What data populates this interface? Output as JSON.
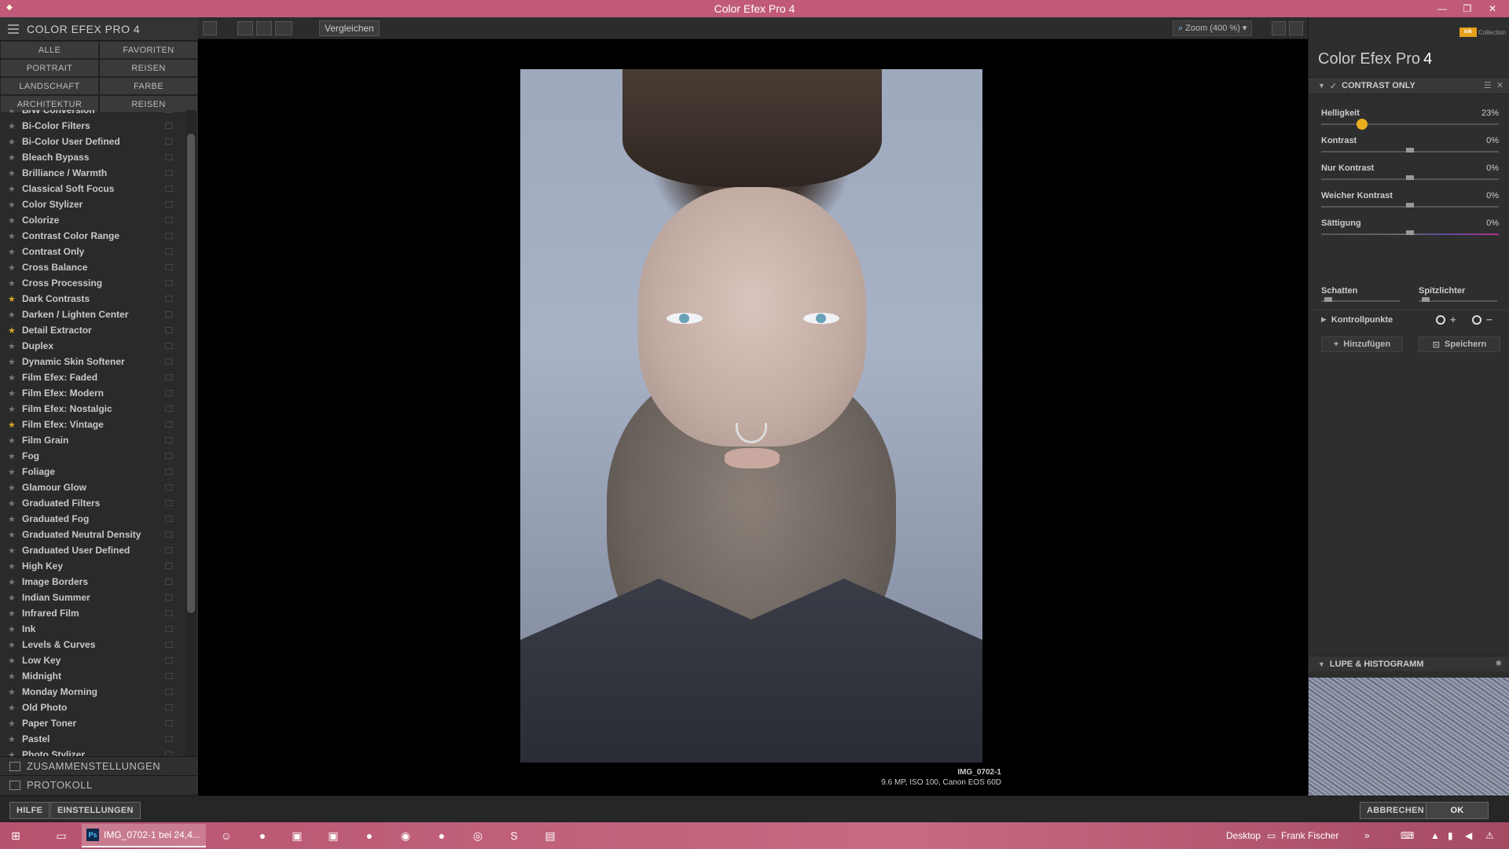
{
  "window": {
    "title": "Color Efex Pro 4"
  },
  "left_panel": {
    "title": "COLOR EFEX PRO 4",
    "categories": [
      "ALLE",
      "FAVORITEN",
      "PORTRAIT",
      "REISEN",
      "LANDSCHAFT",
      "FARBE",
      "ARCHITEKTUR",
      "REISEN"
    ],
    "filters": [
      {
        "name": "B/W Conversion",
        "fav": false
      },
      {
        "name": "Bi-Color Filters",
        "fav": false
      },
      {
        "name": "Bi-Color User Defined",
        "fav": false
      },
      {
        "name": "Bleach Bypass",
        "fav": false
      },
      {
        "name": "Brilliance / Warmth",
        "fav": false
      },
      {
        "name": "Classical Soft Focus",
        "fav": false
      },
      {
        "name": "Color Stylizer",
        "fav": false
      },
      {
        "name": "Colorize",
        "fav": false
      },
      {
        "name": "Contrast Color Range",
        "fav": false
      },
      {
        "name": "Contrast Only",
        "fav": false
      },
      {
        "name": "Cross Balance",
        "fav": false
      },
      {
        "name": "Cross Processing",
        "fav": false
      },
      {
        "name": "Dark Contrasts",
        "fav": true
      },
      {
        "name": "Darken / Lighten Center",
        "fav": false
      },
      {
        "name": "Detail Extractor",
        "fav": true
      },
      {
        "name": "Duplex",
        "fav": false
      },
      {
        "name": "Dynamic Skin Softener",
        "fav": false
      },
      {
        "name": "Film Efex: Faded",
        "fav": false
      },
      {
        "name": "Film Efex: Modern",
        "fav": false
      },
      {
        "name": "Film Efex: Nostalgic",
        "fav": false
      },
      {
        "name": "Film Efex: Vintage",
        "fav": true
      },
      {
        "name": "Film Grain",
        "fav": false
      },
      {
        "name": "Fog",
        "fav": false
      },
      {
        "name": "Foliage",
        "fav": false
      },
      {
        "name": "Glamour Glow",
        "fav": false
      },
      {
        "name": "Graduated Filters",
        "fav": false
      },
      {
        "name": "Graduated Fog",
        "fav": false
      },
      {
        "name": "Graduated Neutral Density",
        "fav": false
      },
      {
        "name": "Graduated User Defined",
        "fav": false
      },
      {
        "name": "High Key",
        "fav": false
      },
      {
        "name": "Image Borders",
        "fav": false
      },
      {
        "name": "Indian Summer",
        "fav": false
      },
      {
        "name": "Infrared Film",
        "fav": false
      },
      {
        "name": "Ink",
        "fav": false
      },
      {
        "name": "Levels & Curves",
        "fav": false
      },
      {
        "name": "Low Key",
        "fav": false
      },
      {
        "name": "Midnight",
        "fav": false
      },
      {
        "name": "Monday Morning",
        "fav": false
      },
      {
        "name": "Old Photo",
        "fav": false
      },
      {
        "name": "Paper Toner",
        "fav": false
      },
      {
        "name": "Pastel",
        "fav": false
      },
      {
        "name": "Photo Stylizer",
        "fav": false
      }
    ],
    "sections": {
      "presets": "ZUSAMMENSTELLUNGEN",
      "history": "PROTOKOLL"
    }
  },
  "toolbar": {
    "compare_label": "Vergleichen",
    "zoom_label": "Zoom (400 %)"
  },
  "image": {
    "filename": "IMG_0702-1",
    "info": "9.6 MP, ISO 100, Canon EOS 60D"
  },
  "right_panel": {
    "nik_label": "Collection",
    "nik_logo": "nik",
    "brand": "Color Efex Pro",
    "brand_version": "4",
    "filter_title": "CONTRAST ONLY",
    "sliders": [
      {
        "label": "Helligkeit",
        "value": "23%",
        "pos": 0.23,
        "gold": true
      },
      {
        "label": "Kontrast",
        "value": "0%",
        "pos": 0.5,
        "gold": false
      },
      {
        "label": "Nur Kontrast",
        "value": "0%",
        "pos": 0.5,
        "gold": false
      },
      {
        "label": "Weicher Kontrast",
        "value": "0%",
        "pos": 0.5,
        "gold": false
      },
      {
        "label": "Sättigung",
        "value": "0%",
        "pos": 0.5,
        "gold": false
      }
    ],
    "shadows_label": "Schatten",
    "highlights_label": "Spitzlichter",
    "controlpoints_label": "Kontrollpunkte",
    "add_label": "Hinzufügen",
    "save_label": "Speichern",
    "loupe_label": "LUPE & HISTOGRAMM"
  },
  "bottom": {
    "help": "HILFE",
    "settings": "EINSTELLUNGEN",
    "cancel": "ABBRECHEN",
    "ok": "OK"
  },
  "taskbar": {
    "active_window": "IMG_0702-1 bei 24,4...",
    "desktop": "Desktop",
    "user": "Frank Fischer"
  }
}
